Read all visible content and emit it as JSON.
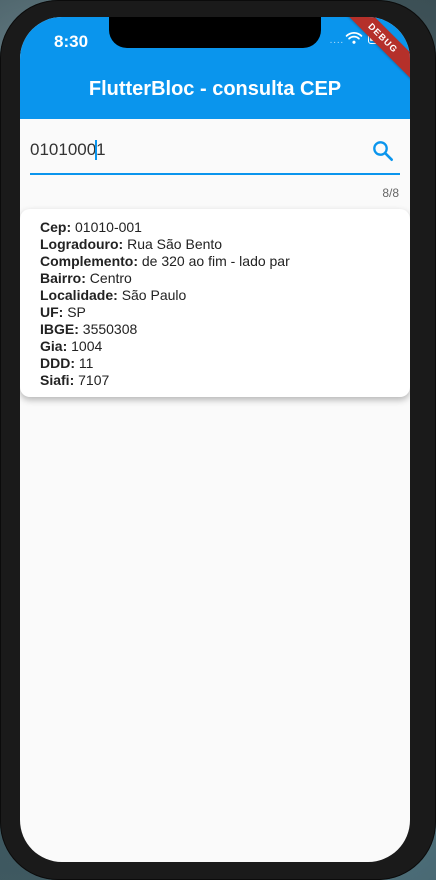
{
  "device": {
    "status_bar": {
      "time": "8:30",
      "dots": "....",
      "wifi_icon": "wifi-icon",
      "battery_icon": "battery-icon",
      "debug_banner": "DEBUG",
      "accent": "#0a95ed"
    }
  },
  "app": {
    "title": "FlutterBloc - consulta CEP"
  },
  "search": {
    "value": "01010001",
    "counter": "8/8",
    "icon": "search-icon"
  },
  "result": {
    "rows": [
      {
        "label": "Cep:",
        "value": "01010-001"
      },
      {
        "label": "Logradouro:",
        "value": "Rua São Bento"
      },
      {
        "label": "Complemento:",
        "value": "de 320 ao fim - lado par"
      },
      {
        "label": "Bairro:",
        "value": "Centro"
      },
      {
        "label": "Localidade:",
        "value": "São Paulo"
      },
      {
        "label": "UF:",
        "value": "SP"
      },
      {
        "label": "IBGE:",
        "value": "3550308"
      },
      {
        "label": "Gia:",
        "value": "1004"
      },
      {
        "label": "DDD:",
        "value": "11"
      },
      {
        "label": "Siafi:",
        "value": "7107"
      }
    ]
  }
}
